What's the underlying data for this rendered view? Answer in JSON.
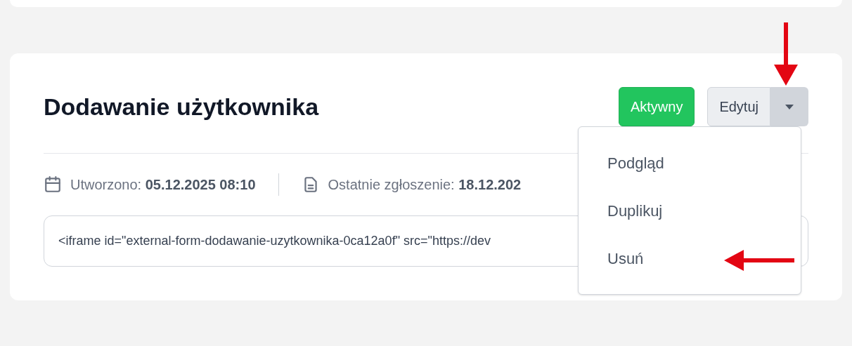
{
  "form_card": {
    "title": "Dodawanie użytkownika",
    "status_button": {
      "label": "Aktywny",
      "active": true
    },
    "edit_button": {
      "label": "Edytuj"
    },
    "meta": [
      {
        "kind": "calendar",
        "label": "Utworzono:",
        "value": "05.12.2025 08:10"
      },
      {
        "kind": "document",
        "label": "Ostatnie zgłoszenie:",
        "value": "18.12.202"
      }
    ],
    "embed_code": "<iframe id=\"external-form-dodawanie-uzytkownika-0ca12a0f\" src=\"https://dev"
  },
  "dropdown_menu": {
    "expanded": true,
    "items": [
      "Podgląd",
      "Duplikuj",
      "Usuń"
    ]
  }
}
